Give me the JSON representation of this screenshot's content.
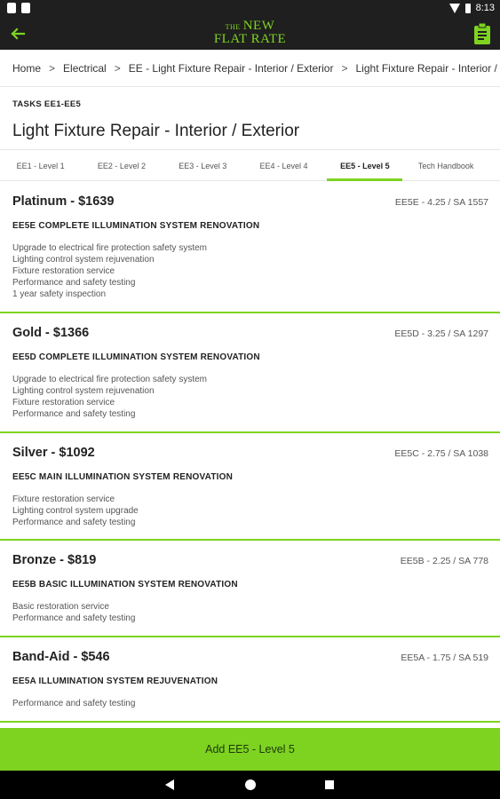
{
  "status_bar": {
    "time": "8:13"
  },
  "app_bar": {
    "logo_the": "THE",
    "logo_new": "NEW",
    "logo_flat_rate": "FLAT RATE"
  },
  "breadcrumb": {
    "items": [
      "Home",
      "Electrical",
      "EE - Light Fixture Repair - Interior / Exterior",
      "Light Fixture Repair - Interior / E"
    ],
    "separator": ">"
  },
  "header": {
    "tasks_label": "TASKS EE1-EE5",
    "title": "Light Fixture Repair - Interior / Exterior"
  },
  "tabs": [
    {
      "label": "EE1 - Level 1",
      "active": false
    },
    {
      "label": "EE2 - Level 2",
      "active": false
    },
    {
      "label": "EE3 - Level 3",
      "active": false
    },
    {
      "label": "EE4 - Level 4",
      "active": false
    },
    {
      "label": "EE5 - Level 5",
      "active": true
    },
    {
      "label": "Tech Handbook",
      "active": false
    }
  ],
  "packages": [
    {
      "title": "Platinum - $1639",
      "code": "EE5E - 4.25 / SA 1557",
      "subtitle": "EE5E COMPLETE ILLUMINATION SYSTEM RENOVATION",
      "features": [
        "Upgrade to electrical fire protection safety system",
        "Lighting control system rejuvenation",
        "Fixture restoration service",
        "Performance and safety testing",
        "1 year safety inspection"
      ]
    },
    {
      "title": "Gold - $1366",
      "code": "EE5D - 3.25 / SA 1297",
      "subtitle": "EE5D COMPLETE ILLUMINATION SYSTEM RENOVATION",
      "features": [
        "Upgrade to electrical fire protection safety system",
        "Lighting control system rejuvenation",
        "Fixture restoration service",
        "Performance and safety testing"
      ]
    },
    {
      "title": "Silver - $1092",
      "code": "EE5C - 2.75 / SA 1038",
      "subtitle": "EE5C MAIN ILLUMINATION SYSTEM RENOVATION",
      "features": [
        "Fixture restoration service",
        "Lighting control system upgrade",
        "Performance and safety testing"
      ]
    },
    {
      "title": "Bronze - $819",
      "code": "EE5B - 2.25 / SA 778",
      "subtitle": "EE5B BASIC ILLUMINATION SYSTEM RENOVATION",
      "features": [
        "Basic restoration service",
        "Performance and safety testing"
      ]
    },
    {
      "title": "Band-Aid - $546",
      "code": "EE5A - 1.75 / SA 519",
      "subtitle": "EE5A ILLUMINATION SYSTEM REJUVENATION",
      "features": [
        "Performance and safety testing"
      ]
    }
  ],
  "add_button": {
    "label": "Add EE5 - Level 5"
  },
  "colors": {
    "accent": "#7ed321",
    "bar": "#1f1f1f"
  }
}
